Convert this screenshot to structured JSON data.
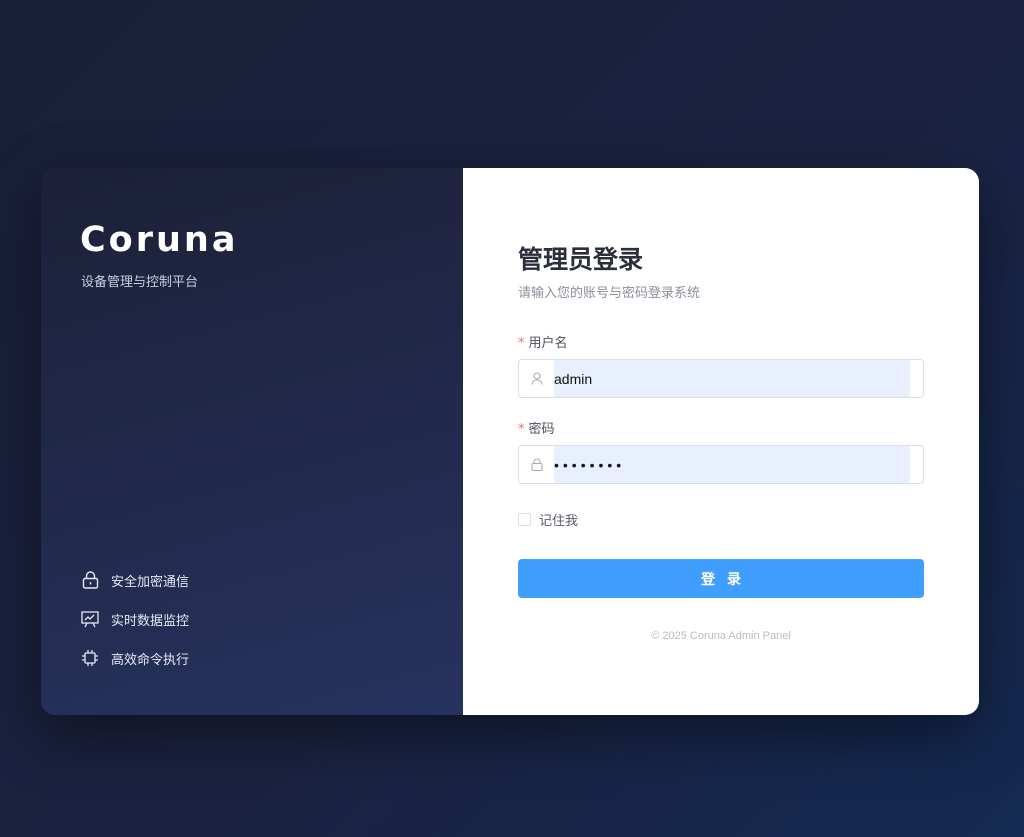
{
  "left_panel": {
    "brand": "Coruna",
    "subtitle": "设备管理与控制平台",
    "features": [
      {
        "icon": "lock-icon",
        "label": "安全加密通信"
      },
      {
        "icon": "chart-board-icon",
        "label": "实时数据监控"
      },
      {
        "icon": "chip-icon",
        "label": "高效命令执行"
      }
    ]
  },
  "login": {
    "title": "管理员登录",
    "subtitle": "请输入您的账号与密码登录系统",
    "username_label": "用户名",
    "username_value": "admin",
    "password_label": "密码",
    "password_value": "••••••••",
    "required_mark": "*",
    "remember_label": "记住我",
    "submit_label": "登录",
    "footer": "© 2025 Coruna Admin Panel"
  },
  "colors": {
    "primary": "#409eff",
    "required": "#f56c6c",
    "autofill": "#e8f0fe"
  }
}
